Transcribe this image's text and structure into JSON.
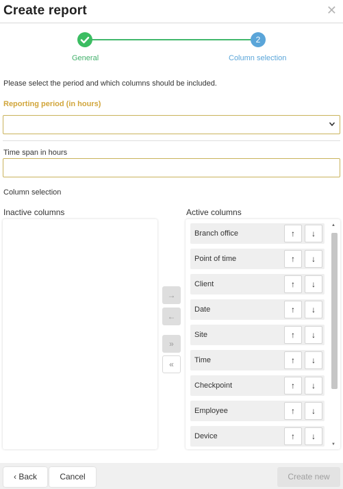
{
  "dialog": {
    "title": "Create report",
    "close_icon": "close-icon"
  },
  "stepper": {
    "steps": [
      {
        "label": "General",
        "state": "completed",
        "icon": "checkmark-icon",
        "color": "#3bbd62"
      },
      {
        "label": "Column selection",
        "state": "current",
        "number": "2",
        "color": "#5aa5d9"
      }
    ]
  },
  "form": {
    "intro": "Please select the period and which columns should be included.",
    "period": {
      "label": "Reporting period (in hours)",
      "value": "",
      "label_color": "#d1a53a"
    },
    "timespan": {
      "label": "Time span in hours",
      "value": "",
      "placeholder": ""
    },
    "column_selection_label": "Column selection"
  },
  "columns": {
    "inactive_heading": "Inactive columns",
    "active_heading": "Active columns",
    "inactive": [],
    "active": [
      "Branch office",
      "Point of time",
      "Client",
      "Date",
      "Site",
      "Time",
      "Checkpoint",
      "Employee",
      "Device"
    ],
    "move_buttons": {
      "move_right": "→",
      "move_left": "←",
      "move_all_right": "»",
      "move_all_left": "«"
    },
    "order_up": "↑",
    "order_down": "↓"
  },
  "footer": {
    "back": "Back",
    "cancel": "Cancel",
    "create": "Create new"
  }
}
